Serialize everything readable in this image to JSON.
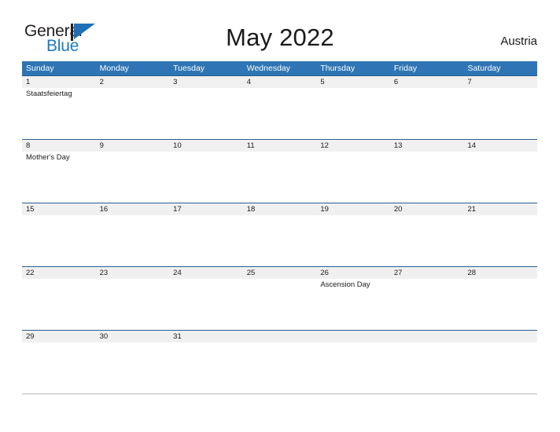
{
  "brand": {
    "name_part1": "General",
    "name_part2": "Blue",
    "flag_color": "#1f6fb6",
    "blue_text_color": "#1f7ac4"
  },
  "header": {
    "title": "May 2022",
    "region": "Austria"
  },
  "theme": {
    "header_blue": "#2f75b5",
    "row_divider_blue": "#2a5d8f",
    "date_band_grey": "#f0f0f0"
  },
  "calendar": {
    "weekdays": [
      "Sunday",
      "Monday",
      "Tuesday",
      "Wednesday",
      "Thursday",
      "Friday",
      "Saturday"
    ],
    "weeks": [
      {
        "dates": [
          "1",
          "2",
          "3",
          "4",
          "5",
          "6",
          "7"
        ],
        "events": [
          "Staatsfeiertag",
          "",
          "",
          "",
          "",
          "",
          ""
        ]
      },
      {
        "dates": [
          "8",
          "9",
          "10",
          "11",
          "12",
          "13",
          "14"
        ],
        "events": [
          "Mother's Day",
          "",
          "",
          "",
          "",
          "",
          ""
        ]
      },
      {
        "dates": [
          "15",
          "16",
          "17",
          "18",
          "19",
          "20",
          "21"
        ],
        "events": [
          "",
          "",
          "",
          "",
          "",
          "",
          ""
        ]
      },
      {
        "dates": [
          "22",
          "23",
          "24",
          "25",
          "26",
          "27",
          "28"
        ],
        "events": [
          "",
          "",
          "",
          "",
          "Ascension Day",
          "",
          ""
        ]
      },
      {
        "dates": [
          "29",
          "30",
          "31",
          "",
          "",
          "",
          ""
        ],
        "events": [
          "",
          "",
          "",
          "",
          "",
          "",
          ""
        ]
      }
    ]
  }
}
